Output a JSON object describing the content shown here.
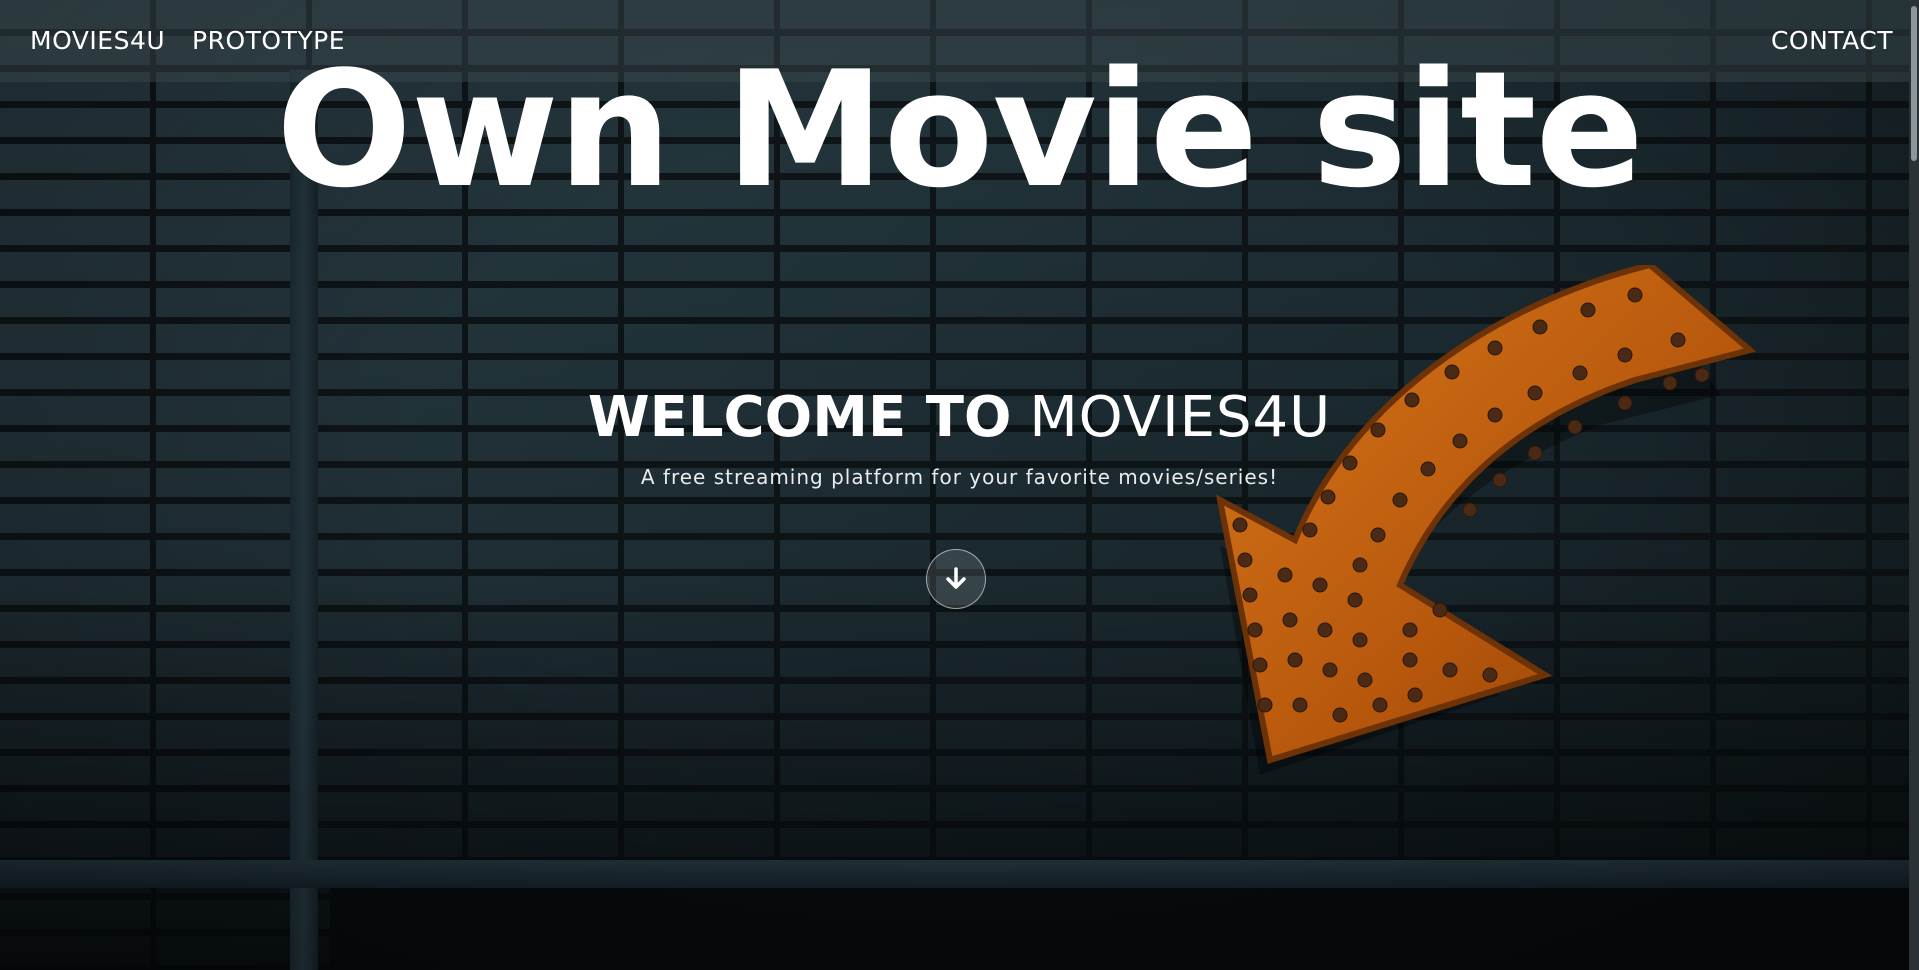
{
  "navbar": {
    "brand": "MOVIES4U",
    "prototype": "PROTOTYPE",
    "contact": "CONTACT"
  },
  "overlay_title": "Own Movie site",
  "hero": {
    "welcome_strong": "WELCOME TO",
    "welcome_light": "MOVIES4U",
    "tagline": "A free streaming platform for your favorite movies/series!",
    "scroll_icon": "arrow-down-icon"
  },
  "colors": {
    "text": "#ffffff",
    "arrow_sign": "#c9640f",
    "arrow_sign_dark": "#7a3a08",
    "navbar_bg": "rgba(60, 75, 80, 0.45)"
  }
}
